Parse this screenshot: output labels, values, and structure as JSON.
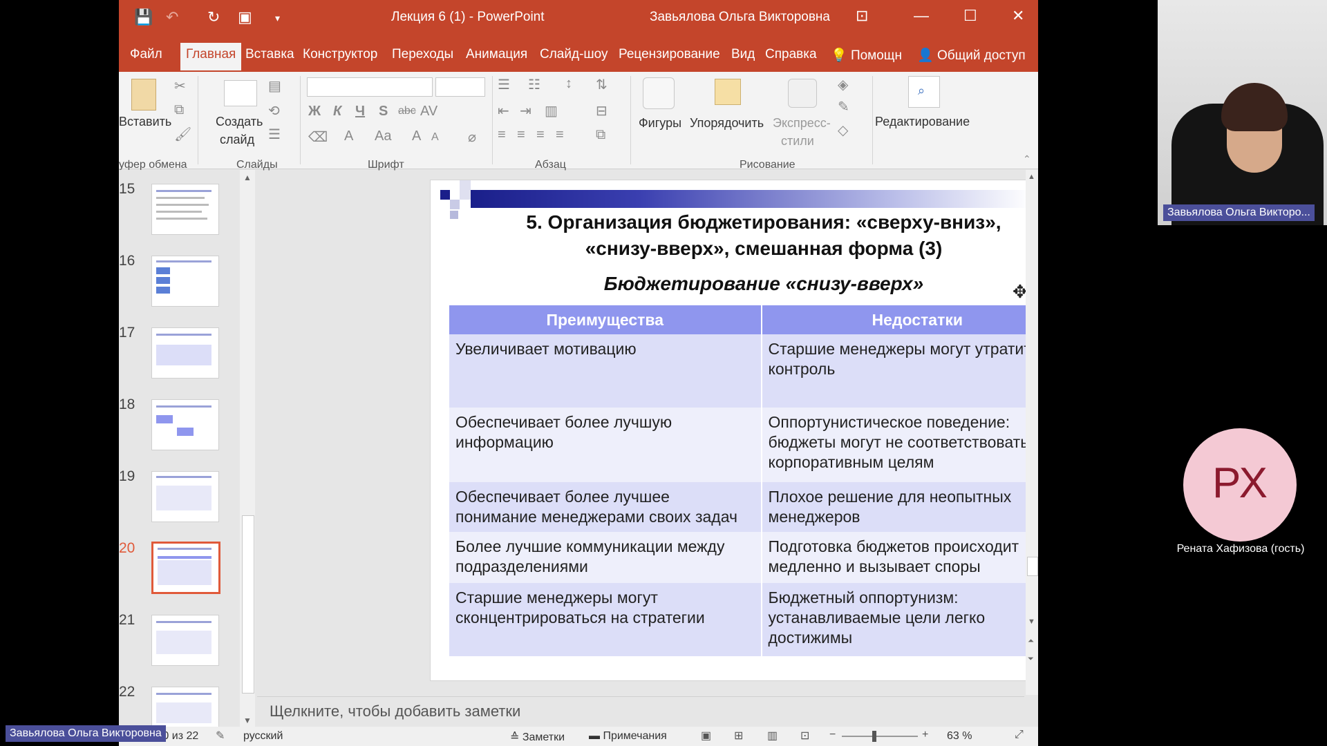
{
  "window": {
    "title": "Лекция 6 (1)  -  PowerPoint",
    "user": "Завьялова Ольга Викторовна"
  },
  "tabs": [
    "Файл",
    "Главная",
    "Вставка",
    "Конструктор",
    "Переходы",
    "Анимация",
    "Слайд-шоу",
    "Рецензирование",
    "Вид",
    "Справка",
    "Помощн",
    "Общий доступ"
  ],
  "ribbon": {
    "paste": "Вставить",
    "new_slide_1": "Создать",
    "new_slide_2": "слайд",
    "shapes": "Фигуры",
    "arrange": "Упорядочить",
    "quick_styles_1": "Экспресс-",
    "quick_styles_2": "стили",
    "editing": "Редактирование",
    "groups": {
      "clipboard": "уфер обмена",
      "slides": "Слайды",
      "font": "Шрифт",
      "paragraph": "Абзац",
      "drawing": "Рисование"
    },
    "font_buttons": {
      "bold": "Ж",
      "italic": "К",
      "underline": "Ч",
      "strike": "S",
      "spacing": "AV",
      "shadow": "abc",
      "color": "A",
      "case": "Aa",
      "grow": "A",
      "shrink": "A"
    }
  },
  "thumbnails": [
    {
      "num": "15"
    },
    {
      "num": "16"
    },
    {
      "num": "17"
    },
    {
      "num": "18"
    },
    {
      "num": "19"
    },
    {
      "num": "20"
    },
    {
      "num": "21"
    },
    {
      "num": "22"
    }
  ],
  "slide": {
    "title_line1": "5. Организация бюджетирования: «сверху-вниз»,",
    "title_line2": "«снизу-вверх», смешанная форма (3)",
    "subtitle": "Бюджетирование «снизу-вверх»",
    "headers": [
      "Преимущества",
      "Недостатки"
    ],
    "rows": [
      [
        "Увеличивает мотивацию",
        "Старшие менеджеры могут утратить контроль"
      ],
      [
        "Обеспечивает более лучшую информацию",
        "Оппортунистическое поведение: бюджеты могут не соответствовать корпоративным целям"
      ],
      [
        "Обеспечивает более лучшее понимание менеджерами своих задач",
        "Плохое решение для неопытных менеджеров"
      ],
      [
        "Более лучшие коммуникации между подразделениями",
        "Подготовка бюджетов происходит медленно и вызывает споры"
      ],
      [
        "Старшие менеджеры могут сконцентрироваться на стратегии",
        "Бюджетный оппортунизм: устанавливаемые цели легко достижимы"
      ]
    ]
  },
  "notes_placeholder": "Щелкните, чтобы добавить заметки",
  "status": {
    "slide_info": "Слайд 20 из 22",
    "language": "русский",
    "notes": "Заметки",
    "comments": "Примечания",
    "zoom": "63 %"
  },
  "participants": {
    "speaker_label": "Завьялова Ольга Викторо...",
    "bottom_label": "Завьялова Ольга Викторовна",
    "guest_initials": "РХ",
    "guest_name": "Рената Хафизова (гость)"
  },
  "colors": {
    "accent": "#c4452b",
    "table_header": "#8f96ee",
    "guest_avatar": "#f4c9d4",
    "guest_initials": "#8b1a2e"
  }
}
